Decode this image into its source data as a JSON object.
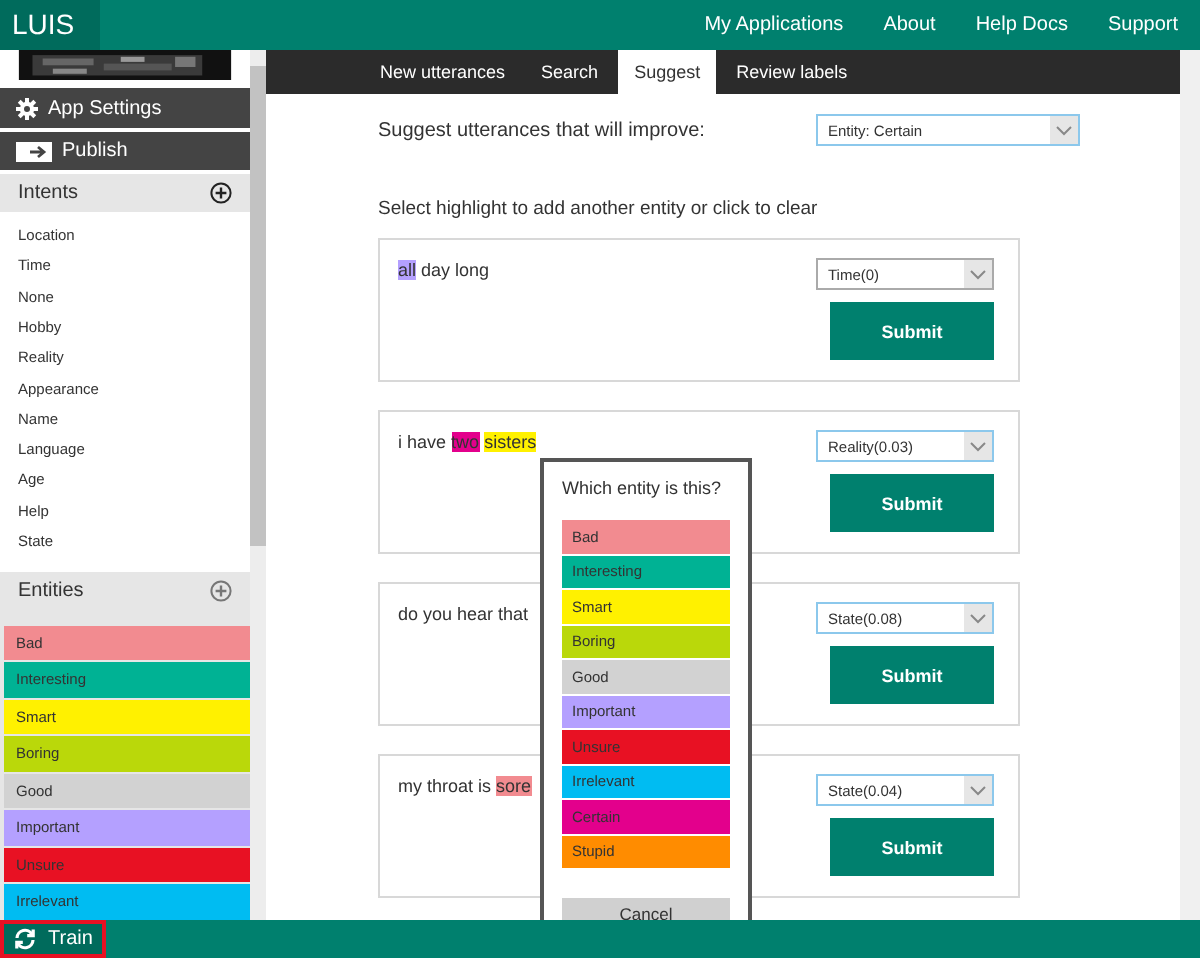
{
  "header": {
    "logo": "LUIS",
    "nav": [
      "My Applications",
      "About",
      "Help Docs",
      "Support"
    ]
  },
  "sidebar": {
    "actions": [
      {
        "kind": "settings",
        "label": "App Settings"
      },
      {
        "kind": "publish",
        "label": "Publish"
      }
    ],
    "intents": {
      "title": "Intents",
      "items": [
        "Location",
        "Time",
        "None",
        "Hobby",
        "Reality",
        "Appearance",
        "Name",
        "Language",
        "Age",
        "Help",
        "State"
      ]
    },
    "entities": {
      "title": "Entities",
      "items": [
        {
          "label": "Bad",
          "color": "#f28b90"
        },
        {
          "label": "Interesting",
          "color": "#00b294"
        },
        {
          "label": "Smart",
          "color": "#fff100"
        },
        {
          "label": "Boring",
          "color": "#bad80a"
        },
        {
          "label": "Good",
          "color": "#d2d2d2"
        },
        {
          "label": "Important",
          "color": "#b4a0ff"
        },
        {
          "label": "Unsure",
          "color": "#e81123"
        },
        {
          "label": "Irrelevant",
          "color": "#00bcf2"
        }
      ]
    }
  },
  "tabs": [
    {
      "label": "New utterances",
      "selected": false
    },
    {
      "label": "Search",
      "selected": false
    },
    {
      "label": "Suggest",
      "selected": true
    },
    {
      "label": "Review labels",
      "selected": false
    }
  ],
  "suggest": {
    "label": "Suggest utterances that will improve:",
    "value": "Entity: Certain"
  },
  "instruction": "Select highlight to add another entity or click to clear",
  "utterances": [
    {
      "segments": [
        {
          "text": "all",
          "color": "#b4a0ff"
        },
        {
          "text": "day long"
        }
      ],
      "intent": "Time(0)",
      "focused": false,
      "button": "Submit"
    },
    {
      "segments": [
        {
          "text": "i have"
        },
        {
          "text": "two",
          "color": "#e3008c"
        },
        {
          "text": "sisters",
          "color": "#fff100"
        }
      ],
      "intent": "Reality(0.03)",
      "focused": true,
      "button": "Submit"
    },
    {
      "segments": [
        {
          "text": "do you hear that"
        }
      ],
      "intent": "State(0.08)",
      "focused": true,
      "button": "Submit"
    },
    {
      "segments": [
        {
          "text": "my throat is"
        },
        {
          "text": "sore",
          "color": "#f28b90"
        }
      ],
      "intent": "State(0.04)",
      "focused": true,
      "button": "Submit"
    }
  ],
  "popup": {
    "title": "Which entity is this?",
    "options": [
      {
        "label": "Bad",
        "color": "#f28b90"
      },
      {
        "label": "Interesting",
        "color": "#00b294"
      },
      {
        "label": "Smart",
        "color": "#fff100"
      },
      {
        "label": "Boring",
        "color": "#bad80a"
      },
      {
        "label": "Good",
        "color": "#d2d2d2"
      },
      {
        "label": "Important",
        "color": "#b4a0ff"
      },
      {
        "label": "Unsure",
        "color": "#e81123"
      },
      {
        "label": "Irrelevant",
        "color": "#00bcf2"
      },
      {
        "label": "Certain",
        "color": "#e3008c"
      },
      {
        "label": "Stupid",
        "color": "#ff8c00"
      }
    ],
    "cancel": "Cancel"
  },
  "footer": {
    "train": "Train"
  }
}
